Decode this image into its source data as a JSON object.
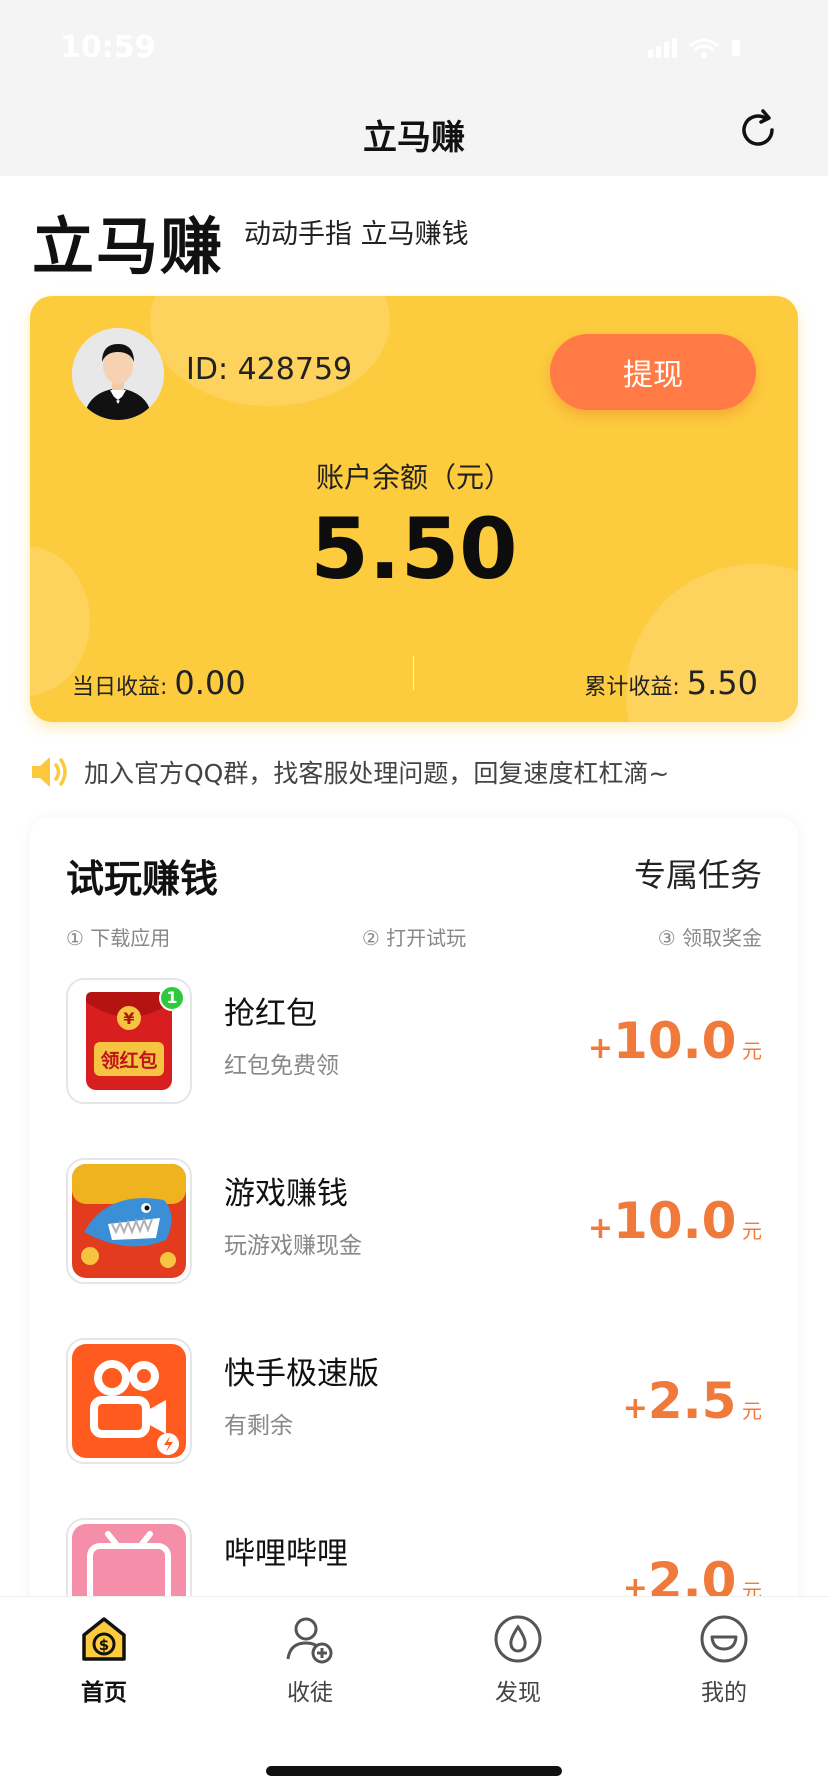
{
  "status": {
    "time": "10:59"
  },
  "nav": {
    "title": "立马赚"
  },
  "header": {
    "brand": "立马赚",
    "slogan": "动动手指 立马赚钱"
  },
  "account": {
    "id_label": "ID: 428759",
    "withdraw_label": "提现",
    "balance_label": "账户余额（元）",
    "balance": "5.50",
    "today_label": "当日收益:",
    "today_value": "0.00",
    "total_label": "累计收益:",
    "total_value": "5.50"
  },
  "notice": {
    "text": "加入官方QQ群，找客服处理问题，回复速度杠杠滴~"
  },
  "tasks": {
    "title": "试玩赚钱",
    "extra": "专属任务",
    "steps": [
      "① 下载应用",
      "② 打开试玩",
      "③ 领取奖金"
    ],
    "items": [
      {
        "name": "抢红包",
        "desc": "红包免费领",
        "plus": "+",
        "reward": "10.0",
        "unit": "元",
        "icon": "red-envelope-icon",
        "icon_text": "领红包",
        "badge": "1"
      },
      {
        "name": "游戏赚钱",
        "desc": "玩游戏赚现金",
        "plus": "+",
        "reward": "10.0",
        "unit": "元",
        "icon": "shark-game-icon"
      },
      {
        "name": "快手极速版",
        "desc": "有剩余",
        "plus": "+",
        "reward": "2.5",
        "unit": "元",
        "icon": "kuaishou-icon"
      },
      {
        "name": "哔哩哔哩",
        "desc": "",
        "plus": "+",
        "reward": "2.0",
        "unit": "元",
        "icon": "bilibili-icon"
      }
    ]
  },
  "tabbar": {
    "items": [
      {
        "label": "首页",
        "icon": "home-coin-icon",
        "active": true
      },
      {
        "label": "收徒",
        "icon": "add-user-icon",
        "active": false
      },
      {
        "label": "发现",
        "icon": "discover-icon",
        "active": false
      },
      {
        "label": "我的",
        "icon": "smile-icon",
        "active": false
      }
    ]
  },
  "colors": {
    "card": "#fdcb3e",
    "accent": "#ff7a45",
    "reward": "#f07a3b"
  }
}
